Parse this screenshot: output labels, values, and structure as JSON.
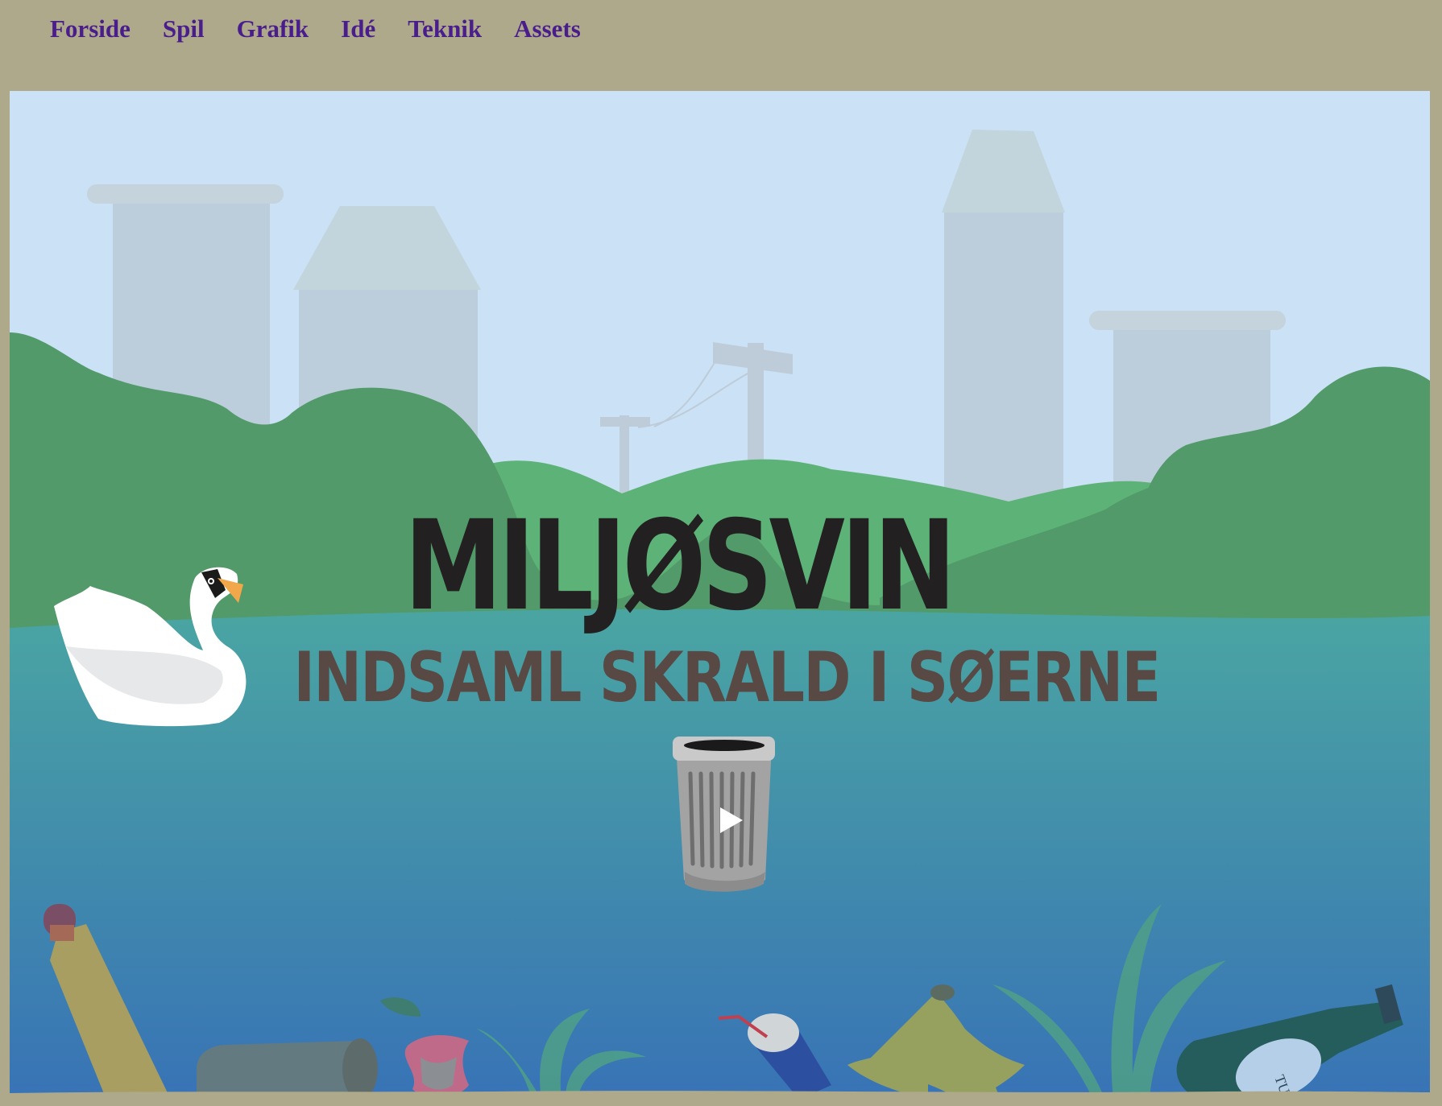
{
  "nav": {
    "items": [
      {
        "label": "Forside"
      },
      {
        "label": "Spil"
      },
      {
        "label": "Grafik"
      },
      {
        "label": "Idé"
      },
      {
        "label": "Teknik"
      },
      {
        "label": "Assets"
      }
    ]
  },
  "game": {
    "title": "MILJØSVIN",
    "subtitle": "INDSAML SKRALD I SØERNE",
    "play_icon": "play-icon",
    "bottle_label": "TUBORG"
  },
  "colors": {
    "page_bg": "#ada98a",
    "nav_link": "#4a1d8c",
    "sky": "#cbe1f5",
    "hills_dark": "#529a69",
    "hills_light": "#5db377",
    "water_top": "#4aa5a2",
    "water_bottom": "#3873b6",
    "title": "#222021",
    "subtitle": "#594944"
  }
}
